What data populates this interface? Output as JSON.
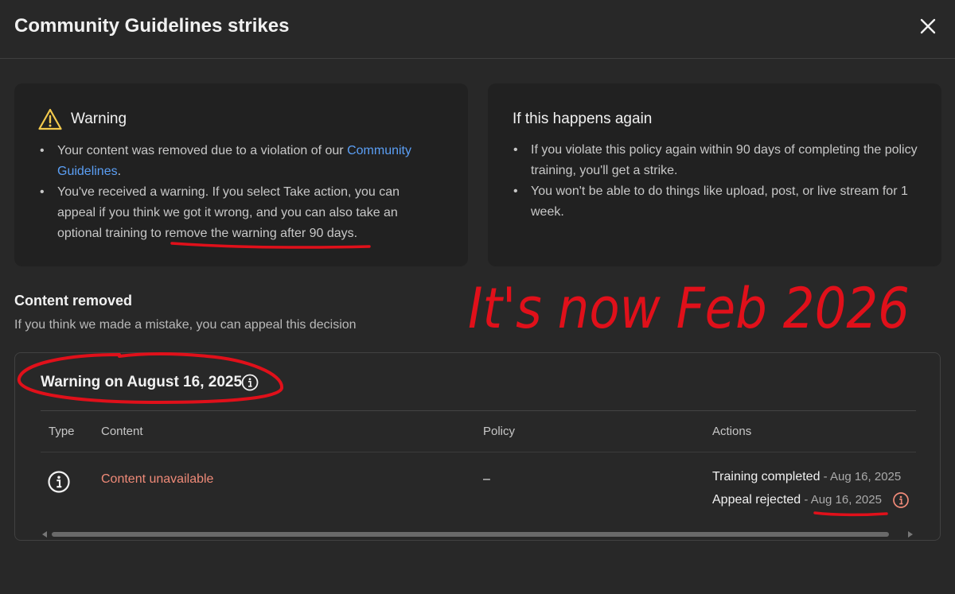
{
  "header": {
    "title": "Community Guidelines strikes"
  },
  "warning_card": {
    "title": "Warning",
    "bullet1_prefix": "Your content was removed due to a violation of our",
    "bullet1_link": "Community Guidelines",
    "bullet1_suffix": ".",
    "bullet2": "You've received a warning. If you select Take action, you can appeal if you think we got it wrong, and you can also take an optional training to remove the warning after 90 days."
  },
  "again_card": {
    "title": "If this happens again",
    "bullet1": "If you violate this policy again within 90 days of completing the policy training, you'll get a strike.",
    "bullet2": "You won't be able to do things like upload, post, or live stream for 1 week."
  },
  "content_removed": {
    "title": "Content removed",
    "subtitle": "If you think we made a mistake, you can appeal this decision"
  },
  "strike": {
    "title": "Warning on August 16, 2025",
    "columns": [
      "Type",
      "Content",
      "Policy",
      "Actions"
    ],
    "row": {
      "content": "Content unavailable",
      "policy": "–",
      "action1_label": "Training completed",
      "action1_date": " - Aug 16, 2025",
      "action2_label": "Appeal rejected",
      "action2_date": " - Aug 16, 2025"
    }
  },
  "annotation": {
    "text": "It's now Feb 2026"
  },
  "colors": {
    "background": "#282828",
    "card": "#212121",
    "link": "#5b9ff5",
    "content_link": "#ef8a78",
    "warning_icon": "#f2c94c",
    "annotation_red": "#e0101a"
  }
}
